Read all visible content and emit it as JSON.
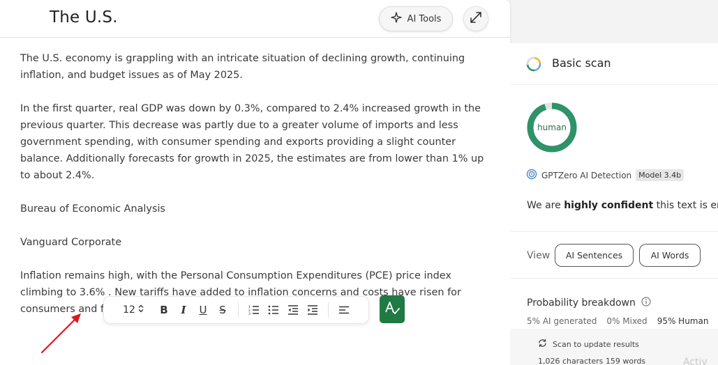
{
  "editor": {
    "title": "The U.S.",
    "ai_tools_label": "AI Tools",
    "paragraphs": [
      "The U.S. economy is grappling with an intricate situation of declining growth, continuing inflation, and budget issues as of May 2025.",
      "In the first quarter, real GDP was down by 0.3%, compared to 2.4% increased growth in the previous quarter. This decrease was partly due to a greater volume of imports and less government spending, with consumer spending and exports providing a slight counter balance. Additionally forecasts for growth in 2025, the estimates are from lower than 1% up to about 2.4%.",
      "Bureau of Economic Analysis",
      "Vanguard Corporate",
      "Inflation remains high, with the Personal Consumption Expenditures (PCE) price index climbing to 3.6% . New tariffs have added to inflation concerns and costs have risen for consumers and firms."
    ]
  },
  "toolbar": {
    "font_size": "12",
    "icons": [
      "bold-icon",
      "italic-icon",
      "underline-icon",
      "strikethrough-icon",
      "numbered-list-icon",
      "bullet-list-icon",
      "outdent-icon",
      "indent-icon",
      "align-left-icon",
      "grammar-check-icon"
    ]
  },
  "scan": {
    "title": "Basic scan",
    "result_label": "human",
    "detector_name": "GPTZero AI Detection",
    "model_badge": "Model 3.4b",
    "confidence_prefix": "We are ",
    "confidence_strong": "highly confident",
    "confidence_suffix": " this text is enti",
    "view_label": "View",
    "ai_sentences_label": "AI Sentences",
    "ai_words_label": "AI Words",
    "probability_title": "Probability breakdown",
    "ai_generated": "5% AI generated",
    "mixed": "0% Mixed",
    "human": "95% Human",
    "human_fraction": 0.95,
    "scan_update_label": "Scan to update results",
    "counts": "1,026 characters 159 words",
    "watermark": "Activ"
  },
  "colors": {
    "ring_human": "#2f9268",
    "ring_track": "#e3e3e3",
    "grammar_button": "#1f7a43",
    "arrow": "#e0161e"
  }
}
